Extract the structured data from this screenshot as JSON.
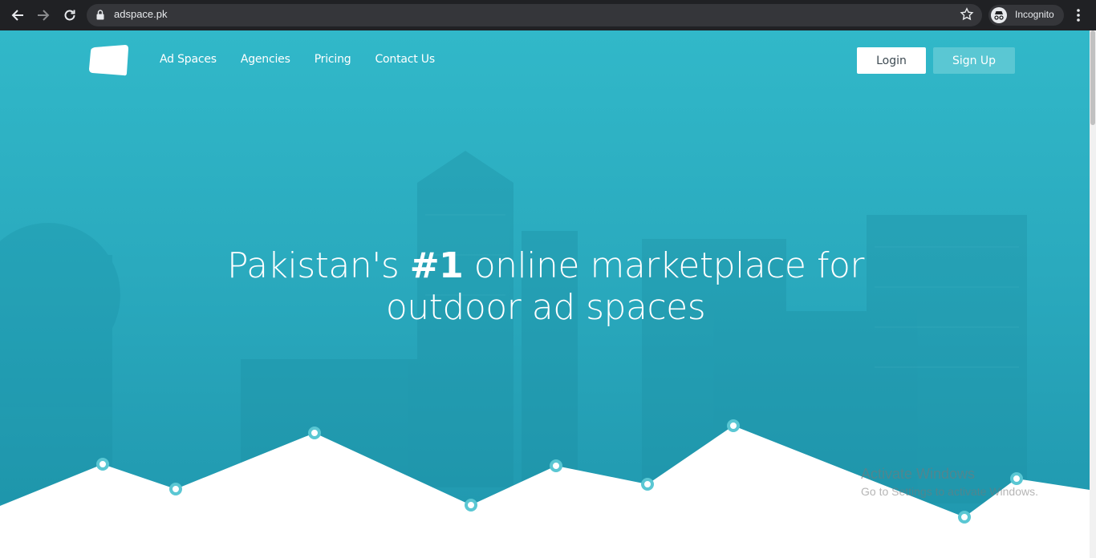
{
  "browser": {
    "url": "adspace.pk",
    "profile_label": "Incognito"
  },
  "nav": {
    "links": [
      "Ad Spaces",
      "Agencies",
      "Pricing",
      "Contact Us"
    ],
    "login_label": "Login",
    "signup_label": "Sign Up"
  },
  "hero": {
    "line1_pre": "Pakistan's ",
    "line1_bold": "#1",
    "line1_post": " online marketplace for",
    "line2": "outdoor ad spaces"
  },
  "watermark": {
    "title": "Activate Windows",
    "subtitle": "Go to Settings to activate Windows."
  },
  "colors": {
    "hero_bg": "#2aaabe",
    "signup_bg": "#5ac7d3",
    "marker": "#5ac7d3"
  }
}
